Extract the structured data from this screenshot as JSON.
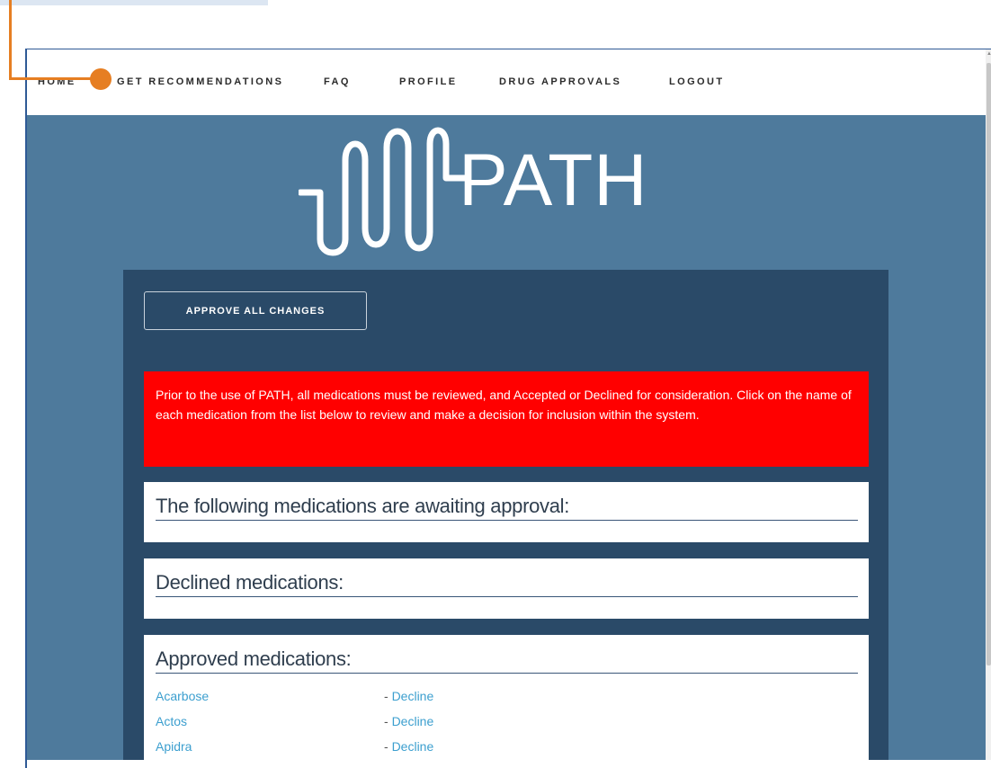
{
  "nav": {
    "items": [
      {
        "label": "HOME"
      },
      {
        "label": "GET RECOMMENDATIONS"
      },
      {
        "label": "FAQ"
      },
      {
        "label": "PROFILE"
      },
      {
        "label": "DRUG APPROVALS"
      },
      {
        "label": "LOGOUT"
      }
    ]
  },
  "logo": {
    "text": "PATH"
  },
  "panel": {
    "approve_button": "APPROVE ALL CHANGES",
    "alert_text": "Prior to the use of PATH, all medications must be reviewed, and Accepted or Declined for consideration. Click on the name of each medication from the list below to review and make a decision for inclusion within the system.",
    "awaiting_title": "The following medications are awaiting approval:",
    "declined_title": "Declined medications:",
    "approved_title": "Approved medications:",
    "approved": [
      {
        "name": "Acarbose",
        "action": "Decline"
      },
      {
        "name": "Actos",
        "action": "Decline"
      },
      {
        "name": "Apidra",
        "action": "Decline"
      }
    ],
    "dash": "- "
  },
  "colors": {
    "hero_bg": "#4e7a9c",
    "panel_bg": "#2a4a68",
    "alert_bg": "#ff0000",
    "link": "#3c9fcf",
    "callout": "#e67e22"
  }
}
